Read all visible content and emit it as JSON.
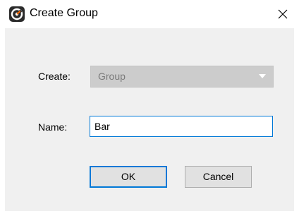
{
  "window": {
    "title": "Create Group",
    "icon": "app-logo-icon",
    "close_icon": "close-icon"
  },
  "form": {
    "create_label": "Create:",
    "create_value": "Group",
    "name_label": "Name:",
    "name_value": "Bar"
  },
  "buttons": {
    "ok_label": "OK",
    "cancel_label": "Cancel"
  },
  "colors": {
    "accent": "#0078d7",
    "dialog_bg": "#f0f0f0",
    "disabled_select_bg": "#cccccc",
    "disabled_text": "#7a7a7a"
  }
}
